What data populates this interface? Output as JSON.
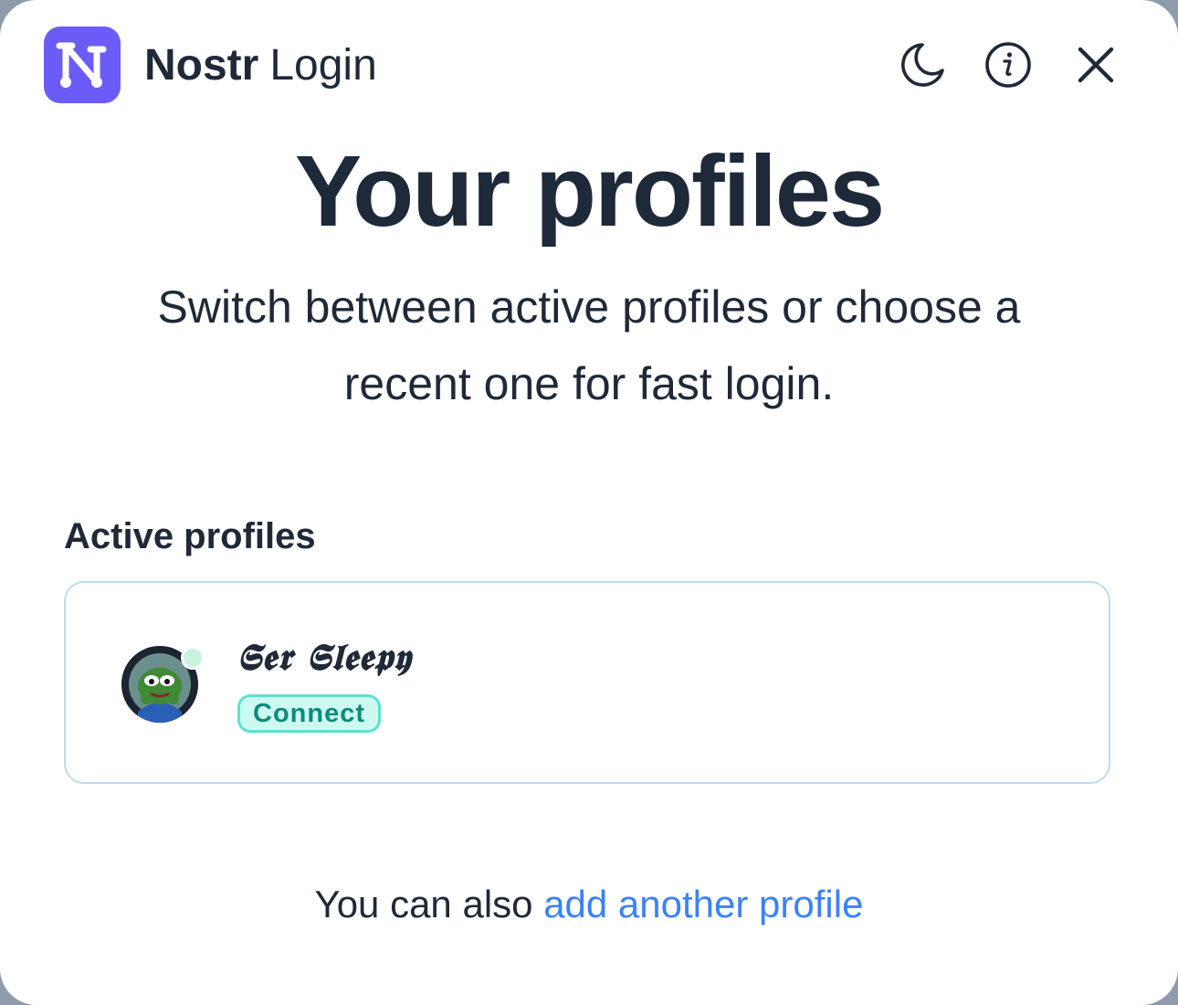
{
  "header": {
    "brand_bold": "Nostr",
    "brand_regular": "Login",
    "icons": [
      "nostr-logo",
      "moon-icon",
      "info-icon",
      "close-icon"
    ]
  },
  "main": {
    "title": "Your profiles",
    "subtitle": "Switch between active profiles or choose a recent one for fast login.",
    "section_label": "Active profiles",
    "profiles": [
      {
        "name": "𝕾𝖊𝖗 𝕾𝖑𝖊𝖊𝖕𝖞",
        "badge": "Connect",
        "status": "online"
      }
    ]
  },
  "footer": {
    "prefix": "You can also",
    "link": "add another profile"
  },
  "colors": {
    "brand": "#6c5cf7",
    "title": "#1e2939",
    "link": "#3b82f6",
    "badge_bg": "#ccfaf1",
    "badge_border": "#5ee0cf",
    "badge_text": "#0f8a7c",
    "card_border": "#bfdbef",
    "status_dot": "#c9f2de"
  }
}
